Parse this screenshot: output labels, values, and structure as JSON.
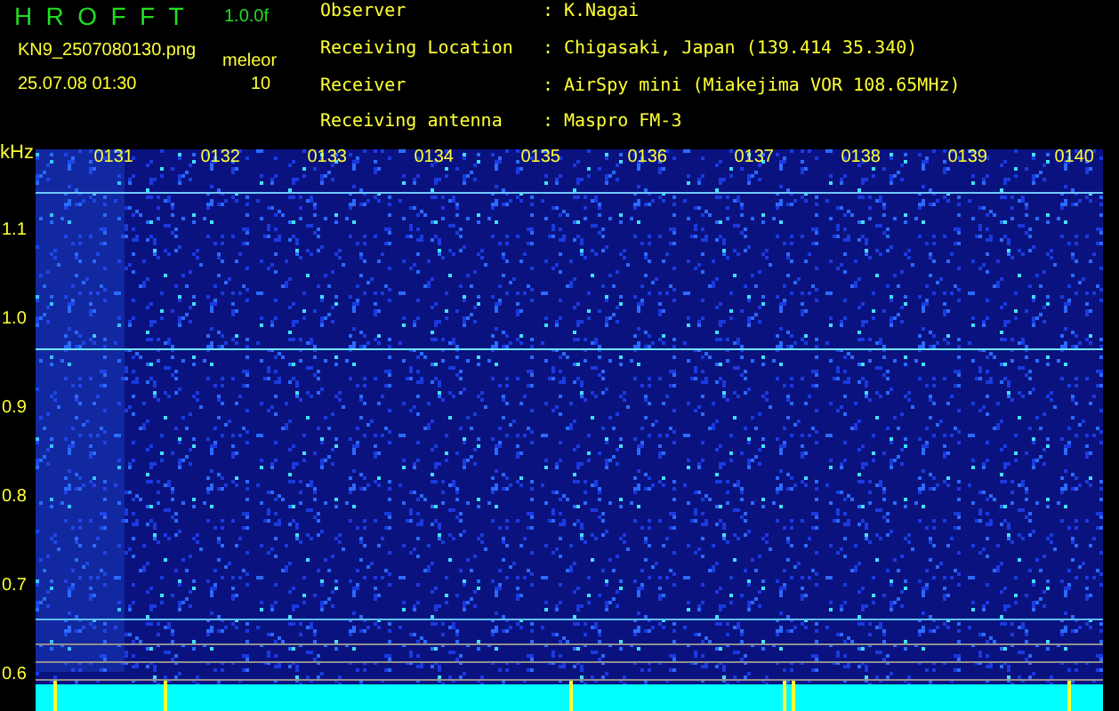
{
  "header": {
    "title": "HROFFT",
    "version": "1.0.0f",
    "filename": "KN9_2507080130.png",
    "datetime": "25.07.08 01:30",
    "meteor_label": "meleor",
    "meteor_count": "10"
  },
  "info": [
    {
      "label": "Observer",
      "value": "K.Nagai"
    },
    {
      "label": "Receiving Location",
      "value": "Chigasaki, Japan (139.414 35.340)"
    },
    {
      "label": "Receiver",
      "value": "AirSpy mini (Miakejima VOR 108.65MHz)"
    },
    {
      "label": "Receiving antenna",
      "value": "Maspro FM-3"
    }
  ],
  "info_separator": ":",
  "spectrogram": {
    "y_unit": "kHz",
    "y_labels": [
      "1.1",
      "1.0",
      "0.9",
      "0.8",
      "0.7",
      "0.6"
    ],
    "time_labels": [
      "0131",
      "0132",
      "0133",
      "0134",
      "0135",
      "0136",
      "0137",
      "0138",
      "0139",
      "0140"
    ]
  }
}
